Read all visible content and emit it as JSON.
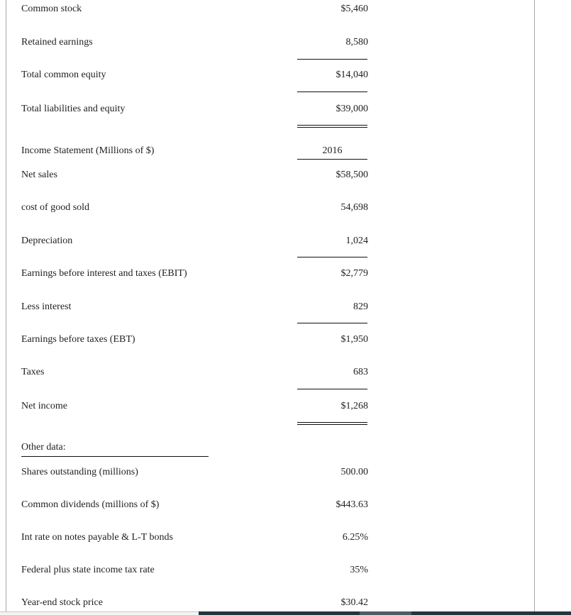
{
  "balance_sheet_tail": [
    {
      "label": "Common stock",
      "value": "$5,460"
    },
    {
      "label": "Retained earnings",
      "value": "8,580"
    },
    {
      "label": "Total common equity",
      "value": "$14,040"
    },
    {
      "label": "Total liabilities and equity",
      "value": "$39,000"
    }
  ],
  "income_statement": {
    "title": "Income Statement (Millions of $)",
    "year": "2016",
    "rows": [
      {
        "label": "Net sales",
        "value": "$58,500"
      },
      {
        "label": "cost of good sold",
        "value": "54,698"
      },
      {
        "label": "Depreciation",
        "value": "1,024"
      },
      {
        "label": "Earnings before interest and taxes (EBIT)",
        "value": "$2,779"
      },
      {
        "label": "Less interest",
        "value": "829"
      },
      {
        "label": "Earnings before taxes (EBT)",
        "value": "$1,950"
      },
      {
        "label": "Taxes",
        "value": "683"
      },
      {
        "label": "Net income",
        "value": "$1,268"
      }
    ]
  },
  "other_data": {
    "title": "Other data:",
    "rows": [
      {
        "label": "Shares outstanding (millions)",
        "value": "500.00"
      },
      {
        "label": "Common dividends (millions of $)",
        "value": "$443.63"
      },
      {
        "label": "Int rate on notes payable & L-T bonds",
        "value": "6.25%"
      },
      {
        "label": "Federal plus state income tax rate",
        "value": "35%"
      },
      {
        "label": "Year-end stock price",
        "value": "$30.42"
      }
    ]
  }
}
